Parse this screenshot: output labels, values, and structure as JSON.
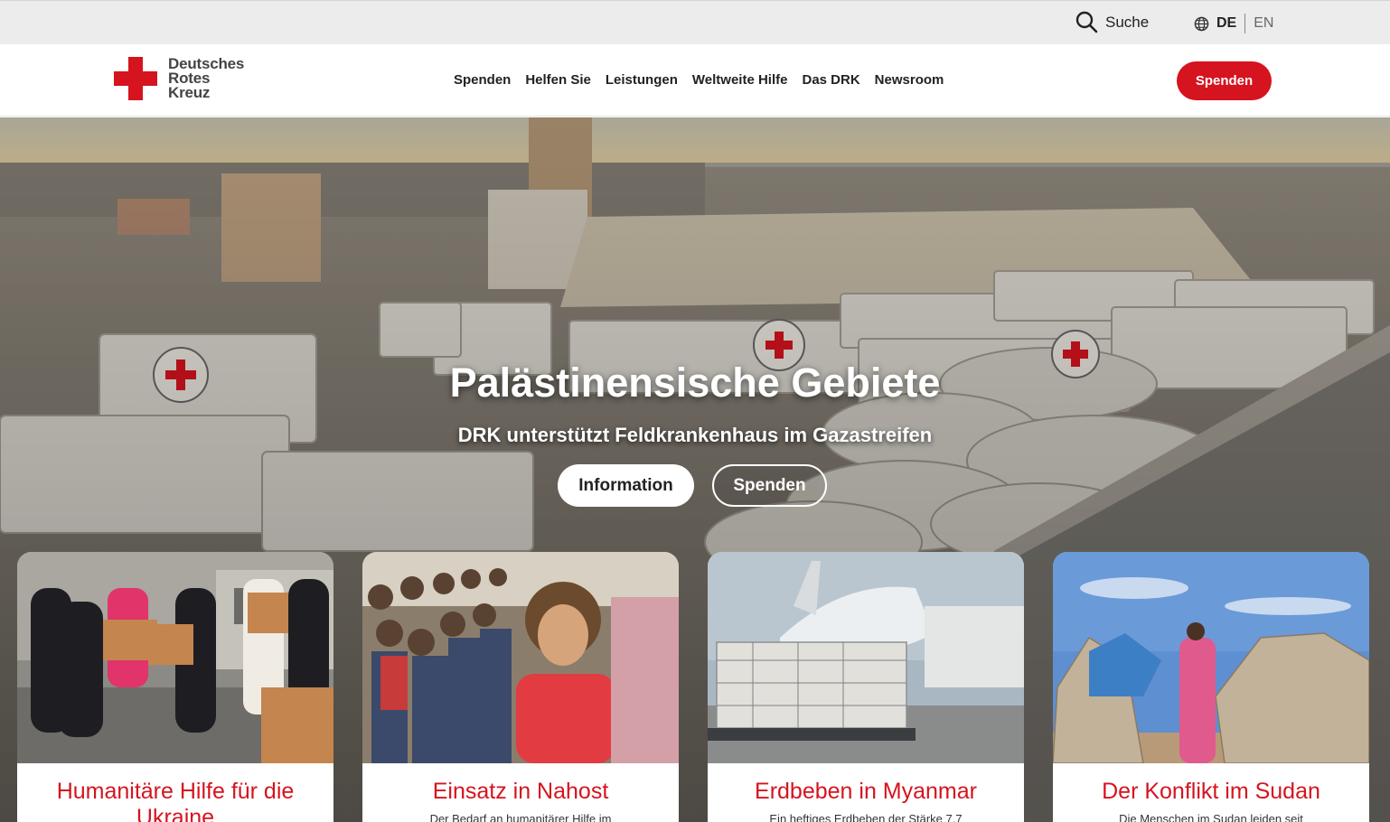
{
  "utility": {
    "search_label": "Suche",
    "lang_de": "DE",
    "lang_en": "EN"
  },
  "logo": {
    "line1": "Deutsches",
    "line2": "Rotes",
    "line3": "Kreuz"
  },
  "nav": {
    "items": [
      {
        "label": "Spenden"
      },
      {
        "label": "Helfen Sie"
      },
      {
        "label": "Leistungen"
      },
      {
        "label": "Weltweite Hilfe"
      },
      {
        "label": "Das DRK"
      },
      {
        "label": "Newsroom"
      }
    ],
    "donate_label": "Spenden"
  },
  "hero": {
    "title": "Palästinensische Gebiete",
    "subtitle": "DRK unterstützt Feldkrankenhaus im Gazastreifen",
    "info_label": "Information",
    "donate_label": "Spenden"
  },
  "cards": [
    {
      "title": "Humanitäre Hilfe für die Ukraine",
      "text": ""
    },
    {
      "title": "Einsatz in Nahost",
      "text": "Der Bedarf an humanitärer Hilfe im"
    },
    {
      "title": "Erdbeben in Myanmar",
      "text": "Ein heftiges Erdbeben der Stärke 7,7"
    },
    {
      "title": "Der Konflikt im Sudan",
      "text": "Die Menschen im Sudan leiden seit"
    }
  ],
  "colors": {
    "brand_red": "#d5141f",
    "utility_bar": "#ececec"
  }
}
